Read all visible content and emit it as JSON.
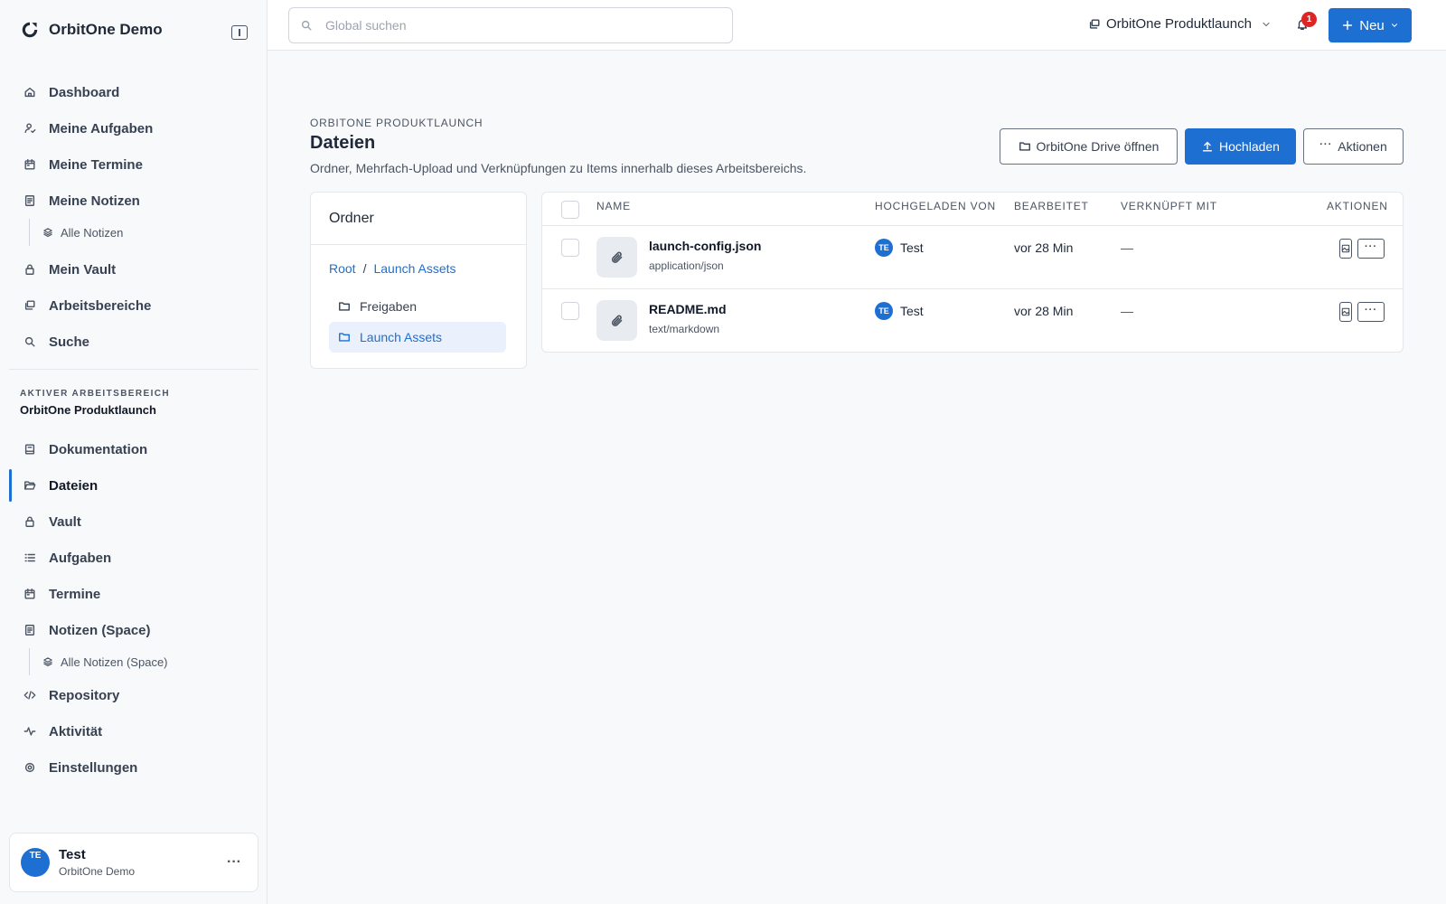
{
  "sidebar": {
    "brand": "OrbitOne Demo",
    "personal_nav": [
      {
        "label": "Dashboard",
        "icon": "home-icon"
      },
      {
        "label": "Meine Aufgaben",
        "icon": "user-check-icon"
      },
      {
        "label": "Meine Termine",
        "icon": "calendar-icon"
      },
      {
        "label": "Meine Notizen",
        "icon": "note-icon"
      },
      {
        "label": "Alle Notizen",
        "icon": "layers-icon"
      },
      {
        "label": "Mein Vault",
        "icon": "lock-icon"
      },
      {
        "label": "Arbeitsbereiche",
        "icon": "workspaces-icon"
      },
      {
        "label": "Suche",
        "icon": "search-icon"
      }
    ],
    "space_label": "AKTIVER ARBEITSBEREICH",
    "space_name": "OrbitOne Produktlaunch",
    "space_nav": [
      {
        "label": "Dokumentation",
        "icon": "book-icon"
      },
      {
        "label": "Dateien",
        "icon": "folder-open-icon",
        "active": true
      },
      {
        "label": "Vault",
        "icon": "lock-icon"
      },
      {
        "label": "Aufgaben",
        "icon": "list-icon"
      },
      {
        "label": "Termine",
        "icon": "calendar-icon"
      },
      {
        "label": "Notizen (Space)",
        "icon": "note-icon"
      },
      {
        "label": "Alle Notizen (Space)",
        "icon": "layers-icon"
      },
      {
        "label": "Repository",
        "icon": "code-icon"
      },
      {
        "label": "Aktivität",
        "icon": "activity-icon"
      },
      {
        "label": "Einstellungen",
        "icon": "settings-icon"
      }
    ],
    "user": {
      "initials": "TE",
      "name": "Test",
      "org": "OrbitOne Demo",
      "more": "···"
    }
  },
  "topbar": {
    "search_placeholder": "Global suchen",
    "workspace": "OrbitOne Produktlaunch",
    "notifications": "1",
    "new_label": "Neu"
  },
  "page": {
    "eyebrow": "ORBITONE PRODUKTLAUNCH",
    "title": "Dateien",
    "description": "Ordner, Mehrfach-Upload und Verknüpfungen zu Items innerhalb dieses Arbeitsbereichs.",
    "actions": {
      "drive": "OrbitOne Drive öffnen",
      "upload": "Hochladen",
      "more": "Aktionen"
    }
  },
  "folders": {
    "title": "Ordner",
    "breadcrumb": [
      "Root",
      "Launch Assets"
    ],
    "separator": "/",
    "items": [
      {
        "label": "Freigaben",
        "active": false
      },
      {
        "label": "Launch Assets",
        "active": true
      }
    ]
  },
  "files": {
    "columns": {
      "name": "NAME",
      "uploaded_by": "HOCHGELADEN VON",
      "edited": "BEARBEITET",
      "linked": "VERKNÜPFT MIT",
      "actions": "AKTIONEN"
    },
    "rows": [
      {
        "name": "launch-config.json",
        "type": "application/json",
        "uploader_initials": "TE",
        "uploader": "Test",
        "edited": "vor 28 Min",
        "linked": "—"
      },
      {
        "name": "README.md",
        "type": "text/markdown",
        "uploader_initials": "TE",
        "uploader": "Test",
        "edited": "vor 28 Min",
        "linked": "—"
      }
    ]
  },
  "colors": {
    "accent": "#1d6fd1",
    "badge": "#dc2626"
  }
}
